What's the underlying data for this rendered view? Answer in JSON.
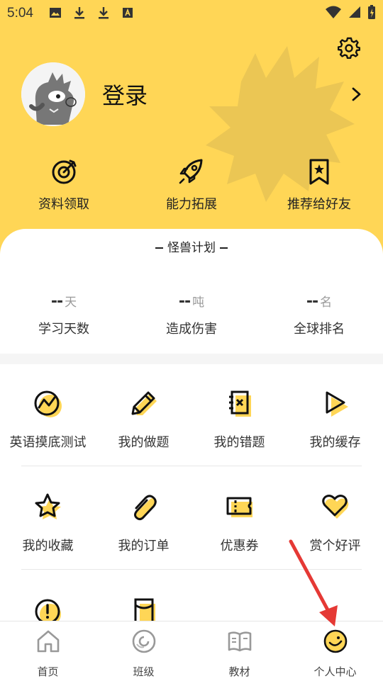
{
  "status_bar": {
    "time": "5:04"
  },
  "profile": {
    "login_label": "登录"
  },
  "quick_actions": [
    {
      "label": "资料领取",
      "icon": "target-icon"
    },
    {
      "label": "能力拓展",
      "icon": "rocket-icon"
    },
    {
      "label": "推荐给好友",
      "icon": "bookmark-star-icon"
    }
  ],
  "plan": {
    "title": "怪兽计划",
    "stats": [
      {
        "value": "--",
        "unit": "天",
        "label": "学习天数"
      },
      {
        "value": "--",
        "unit": "吨",
        "label": "造成伤害"
      },
      {
        "value": "--",
        "unit": "名",
        "label": "全球排名"
      }
    ]
  },
  "menu": {
    "row1": [
      {
        "label": "英语摸底测试",
        "icon": "trend-chart-icon"
      },
      {
        "label": "我的做题",
        "icon": "pencil-icon"
      },
      {
        "label": "我的错题",
        "icon": "wrong-notebook-icon"
      },
      {
        "label": "我的缓存",
        "icon": "play-icon"
      }
    ],
    "row2": [
      {
        "label": "我的收藏",
        "icon": "star-icon"
      },
      {
        "label": "我的订单",
        "icon": "paperclip-icon"
      },
      {
        "label": "优惠券",
        "icon": "coupon-icon"
      },
      {
        "label": "赏个好评",
        "icon": "heart-icon"
      }
    ],
    "row3": [
      {
        "label": "",
        "icon": "alert-icon"
      },
      {
        "label": "",
        "icon": "red-envelope-icon"
      }
    ]
  },
  "tabbar": [
    {
      "label": "首页",
      "icon": "home-icon"
    },
    {
      "label": "班级",
      "icon": "class-icon"
    },
    {
      "label": "教材",
      "icon": "book-icon"
    },
    {
      "label": "个人中心",
      "icon": "smiley-icon"
    }
  ],
  "colors": {
    "accent": "#FFD656",
    "annotation_arrow": "#E53935"
  }
}
